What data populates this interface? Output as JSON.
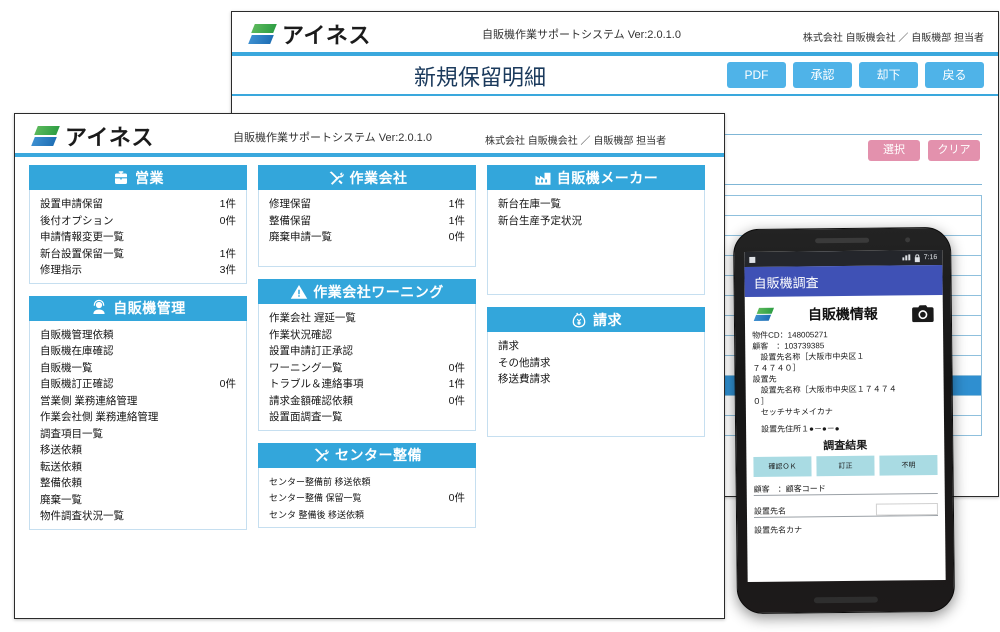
{
  "brand": {
    "logo_text": "アイネス",
    "accent_blue": "#33a6db",
    "header_blue": "#3aa8dd",
    "pink": "#e391ad",
    "appbar_indigo": "#3f51b5"
  },
  "back_window": {
    "system_title": "自販機作業サポートシステム Ver:2.0.1.0",
    "user_info": "株式会社 自販機会社 ／ 自販機部 担当者",
    "page_title": "新規保留明細",
    "buttons": [
      {
        "label": "PDF",
        "name": "pdf-button"
      },
      {
        "label": "承認",
        "name": "approve-button"
      },
      {
        "label": "却下",
        "name": "reject-button"
      },
      {
        "label": "戻る",
        "name": "back-button"
      }
    ],
    "select_value": "",
    "action_buttons": [
      {
        "label": "選択",
        "name": "select-button"
      },
      {
        "label": "クリア",
        "name": "clear-button"
      }
    ]
  },
  "front_window": {
    "system_title": "自販機作業サポートシステム Ver:2.0.1.0",
    "user_info": "株式会社 自販機会社 ／ 自販機部 担当者",
    "columns": [
      {
        "panels": [
          {
            "title": "営業",
            "icon": "briefcase-icon",
            "items": [
              {
                "label": "設置申請保留",
                "count": "1件"
              },
              {
                "label": "後付オプション",
                "count": "0件"
              },
              {
                "label": "申請情報変更一覧",
                "count": ""
              },
              {
                "label": "新台設置保留一覧",
                "count": "1件"
              },
              {
                "label": "修理指示",
                "count": "3件"
              }
            ]
          },
          {
            "title": "自販機管理",
            "icon": "user-headset-icon",
            "items": [
              {
                "label": "自販機管理依頼",
                "count": ""
              },
              {
                "label": "自販機在庫確認",
                "count": ""
              },
              {
                "label": "自販機一覧",
                "count": ""
              },
              {
                "label": "自販機訂正確認",
                "count": "0件"
              },
              {
                "label": "営業側 業務連絡管理",
                "count": ""
              },
              {
                "label": "作業会社側 業務連絡管理",
                "count": ""
              },
              {
                "label": "調査項目一覧",
                "count": ""
              },
              {
                "label": "移送依頼",
                "count": ""
              },
              {
                "label": "転送依頼",
                "count": ""
              },
              {
                "label": "整備依頼",
                "count": ""
              },
              {
                "label": "廃棄一覧",
                "count": ""
              },
              {
                "label": "物件調査状況一覧",
                "count": ""
              }
            ]
          }
        ]
      },
      {
        "panels": [
          {
            "title": "作業会社",
            "icon": "tools-icon",
            "items": [
              {
                "label": "修理保留",
                "count": "1件"
              },
              {
                "label": "整備保留",
                "count": "1件"
              },
              {
                "label": "廃棄申請一覧",
                "count": "0件"
              }
            ]
          },
          {
            "title": "作業会社ワーニング",
            "icon": "warning-icon",
            "items": [
              {
                "label": "作業会社 遅延一覧",
                "count": ""
              },
              {
                "label": "作業状況確認",
                "count": ""
              },
              {
                "label": "設置申請訂正承認",
                "count": ""
              },
              {
                "label": "ワーニング一覧",
                "count": "0件"
              },
              {
                "label": "トラブル＆連絡事項",
                "count": "1件"
              },
              {
                "label": "請求金額確認依頼",
                "count": "0件"
              },
              {
                "label": "設置面調査一覧",
                "count": ""
              }
            ]
          },
          {
            "title": "センター整備",
            "icon": "tools-icon",
            "items": [
              {
                "label": "センター整備前 移送依頼",
                "count": ""
              },
              {
                "label": "センター整備 保留一覧",
                "count": "0件"
              },
              {
                "label": "センタ 整備後 移送依頼",
                "count": ""
              }
            ]
          }
        ]
      },
      {
        "panels": [
          {
            "title": "自販機メーカー",
            "icon": "factory-icon",
            "items": [
              {
                "label": "新台在庫一覧",
                "count": ""
              },
              {
                "label": "新台生産予定状況",
                "count": ""
              }
            ]
          },
          {
            "title": "請求",
            "icon": "money-bag-icon",
            "items": [
              {
                "label": "請求",
                "count": ""
              },
              {
                "label": "その他請求",
                "count": ""
              },
              {
                "label": "移送費請求",
                "count": ""
              }
            ]
          }
        ]
      }
    ]
  },
  "phone": {
    "status_time": "7:16",
    "appbar_title": "自販機調査",
    "screen_title": "自販機情報",
    "camera_icon": "camera-icon",
    "details": [
      "物件CD：148005271",
      "顧客　：103739385",
      "　設置先名称［大阪市中央区１",
      "７４７４０］",
      "設置先",
      "　設置先名称［大阪市中央区１７４７４",
      "０］",
      "　セッチサキメイカナ",
      "",
      "　設置先住所１●－●－●"
    ],
    "result_heading": "調査結果",
    "result_buttons": [
      {
        "label": "確認ＯＫ",
        "name": "confirm-ok-button"
      },
      {
        "label": "訂正",
        "name": "correct-button"
      },
      {
        "label": "不明",
        "name": "unknown-button"
      }
    ],
    "fields": [
      {
        "label": "顧客　：顧客コード",
        "name": "customer-code-field",
        "has_box": false
      },
      {
        "label": "設置先名",
        "name": "site-name-field",
        "has_box": true
      },
      {
        "label": "設置先名カナ",
        "name": "site-name-kana-field",
        "has_box": false
      }
    ]
  }
}
